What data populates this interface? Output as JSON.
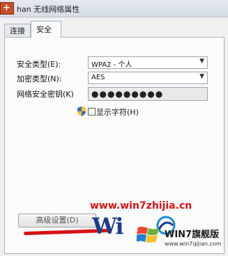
{
  "window": {
    "title": "han 无线网络属性"
  },
  "tabs": [
    {
      "label": "连接"
    },
    {
      "label": "安全"
    }
  ],
  "security": {
    "type_label": "安全类型(E):",
    "type_value": "WPA2 - 个人",
    "encryption_label": "加密类型(N):",
    "encryption_value": "AES",
    "key_label": "网络安全密钥(K)",
    "key_value": "●●●●●●●●●",
    "show_chars_label": "显示字符(H)"
  },
  "advanced_button": {
    "label": "高级设置(D)"
  },
  "watermark": {
    "url": "www.win7zhijia.cn",
    "big_text": "Wi",
    "brand": "WIN7旗舰版",
    "brand_url": "www.win7qijian.com"
  },
  "colors": {
    "watermark_red": "#d11111",
    "logo_blue": "#1a3c8a"
  }
}
